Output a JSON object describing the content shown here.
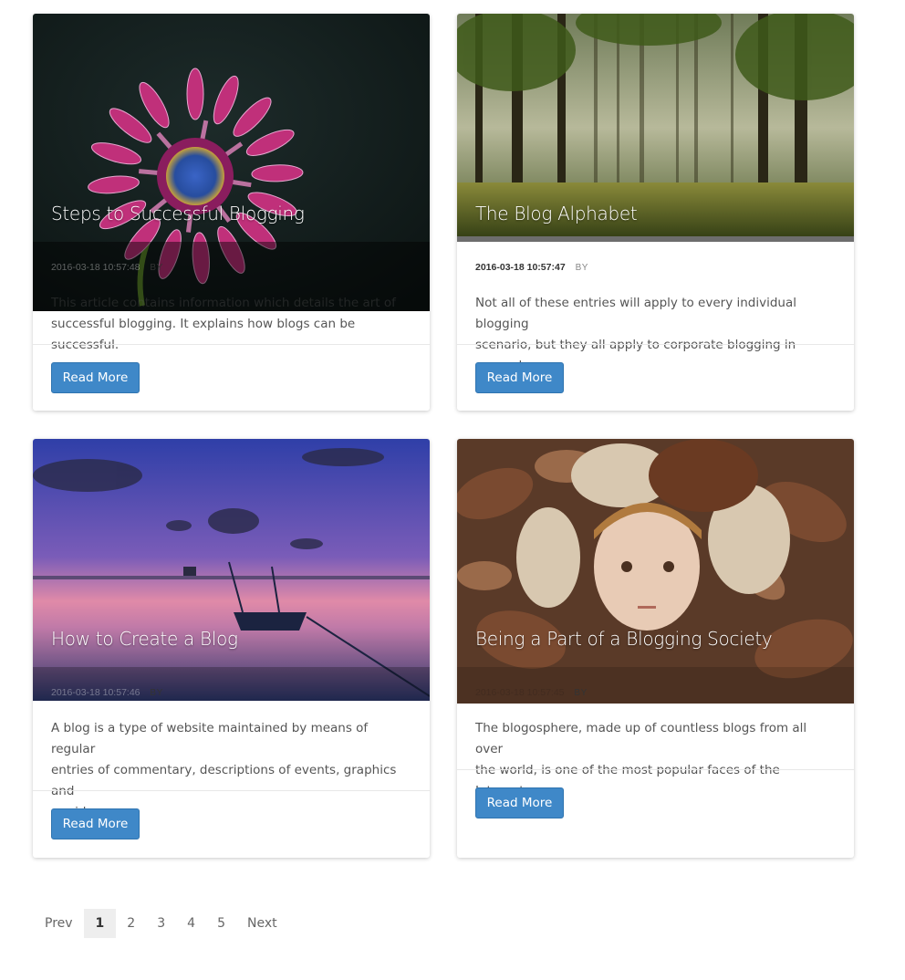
{
  "posts": [
    {
      "title": "Steps to Successful Blogging",
      "date": "2016-03-18 10:57:48",
      "by_label": "BY",
      "excerpt_line1": "This article contains information which details the art of",
      "excerpt_line2": "successful blogging. It explains how blogs can be successful.",
      "button_label": "Read More"
    },
    {
      "title": "The Blog Alphabet",
      "date": "2016-03-18 10:57:47",
      "by_label": "BY",
      "excerpt_line1": "Not all of these entries will apply to every individual blogging",
      "excerpt_line2": "scenario, but they all apply to corporate blogging in general.",
      "button_label": "Read More"
    },
    {
      "title": "How to Create a Blog",
      "date": "2016-03-18 10:57:46",
      "by_label": "BY",
      "excerpt_line1": "A blog is a type of website maintained by means of regular",
      "excerpt_line2": "entries of commentary, descriptions of events, graphics and",
      "excerpt_line3": "or video.",
      "button_label": "Read More"
    },
    {
      "title": "Being a Part of a Blogging Society",
      "date": "2016-03-18 10:57:45",
      "by_label": "BY",
      "excerpt_line1": "The blogosphere, made up of countless blogs from all over",
      "excerpt_line2": "the world, is one of the most popular faces of the Internet.",
      "button_label": "Read More"
    }
  ],
  "pagination": {
    "prev": "Prev",
    "pages": [
      "1",
      "2",
      "3",
      "4",
      "5"
    ],
    "current": "1",
    "next": "Next"
  },
  "colors": {
    "button": "#3f88c8",
    "active_page_bg": "#eeeeee"
  }
}
